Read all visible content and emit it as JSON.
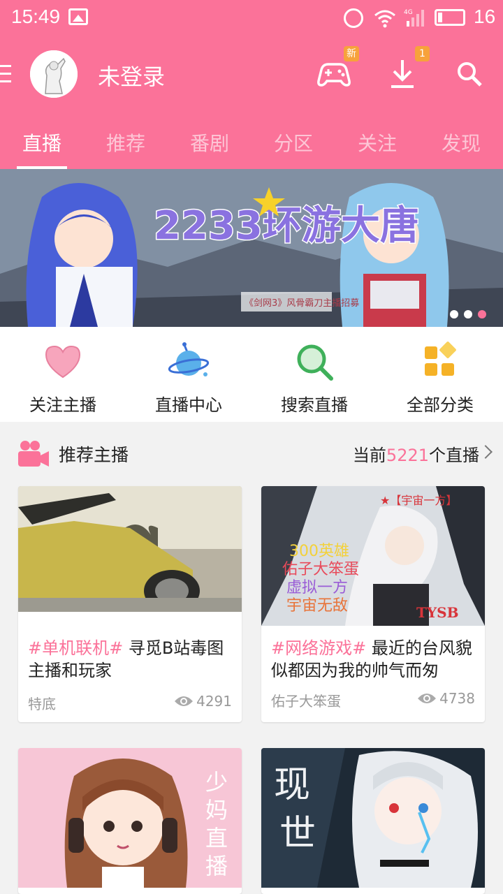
{
  "status_bar": {
    "time": "15:49",
    "battery": "16",
    "network": "4G"
  },
  "top_bar": {
    "username": "未登录",
    "game_badge": "新",
    "download_badge": "1"
  },
  "tabs": [
    {
      "label": "直播",
      "active": true
    },
    {
      "label": "推荐"
    },
    {
      "label": "番剧"
    },
    {
      "label": "分区"
    },
    {
      "label": "关注"
    },
    {
      "label": "发现"
    }
  ],
  "banner": {
    "title_main": "2233环游大唐",
    "subtitle": "《剑网3》风骨霸刀主播招募",
    "page_count": 3,
    "current_page": 3
  },
  "quick_actions": [
    {
      "label": "关注主播",
      "icon": "heart-icon"
    },
    {
      "label": "直播中心",
      "icon": "planet-icon"
    },
    {
      "label": "搜索直播",
      "icon": "search-magnifier-icon"
    },
    {
      "label": "全部分类",
      "icon": "category-grid-icon"
    }
  ],
  "section": {
    "title": "推荐主播",
    "count_prefix": "当前",
    "count_number": "5221",
    "count_suffix": "个直播"
  },
  "cards": [
    {
      "tag": "#单机联机#",
      "title": " 寻觅B站毒图主播和玩家",
      "user": "特底",
      "views": "4291"
    },
    {
      "tag": "#网络游戏#",
      "title": " 最近的台风貌似都因为我的帅气而匆",
      "user": "佑子大笨蛋",
      "views": "4738",
      "art_text": [
        "300英雄",
        "佑子大笨蛋",
        "虚拟一方",
        "宇宙无敌"
      ],
      "art_badge": "★【宇宙一方】",
      "art_sign": "TYSB"
    },
    {
      "tag": "",
      "title": "",
      "user": "",
      "views": "",
      "art_text": [
        "少",
        "妈",
        "直",
        "播"
      ]
    },
    {
      "tag": "",
      "title": "",
      "user": "",
      "views": "",
      "art_text": [
        "现",
        "世"
      ]
    }
  ],
  "colors": {
    "brand": "#fb7299",
    "badge": "#f7a23b"
  }
}
